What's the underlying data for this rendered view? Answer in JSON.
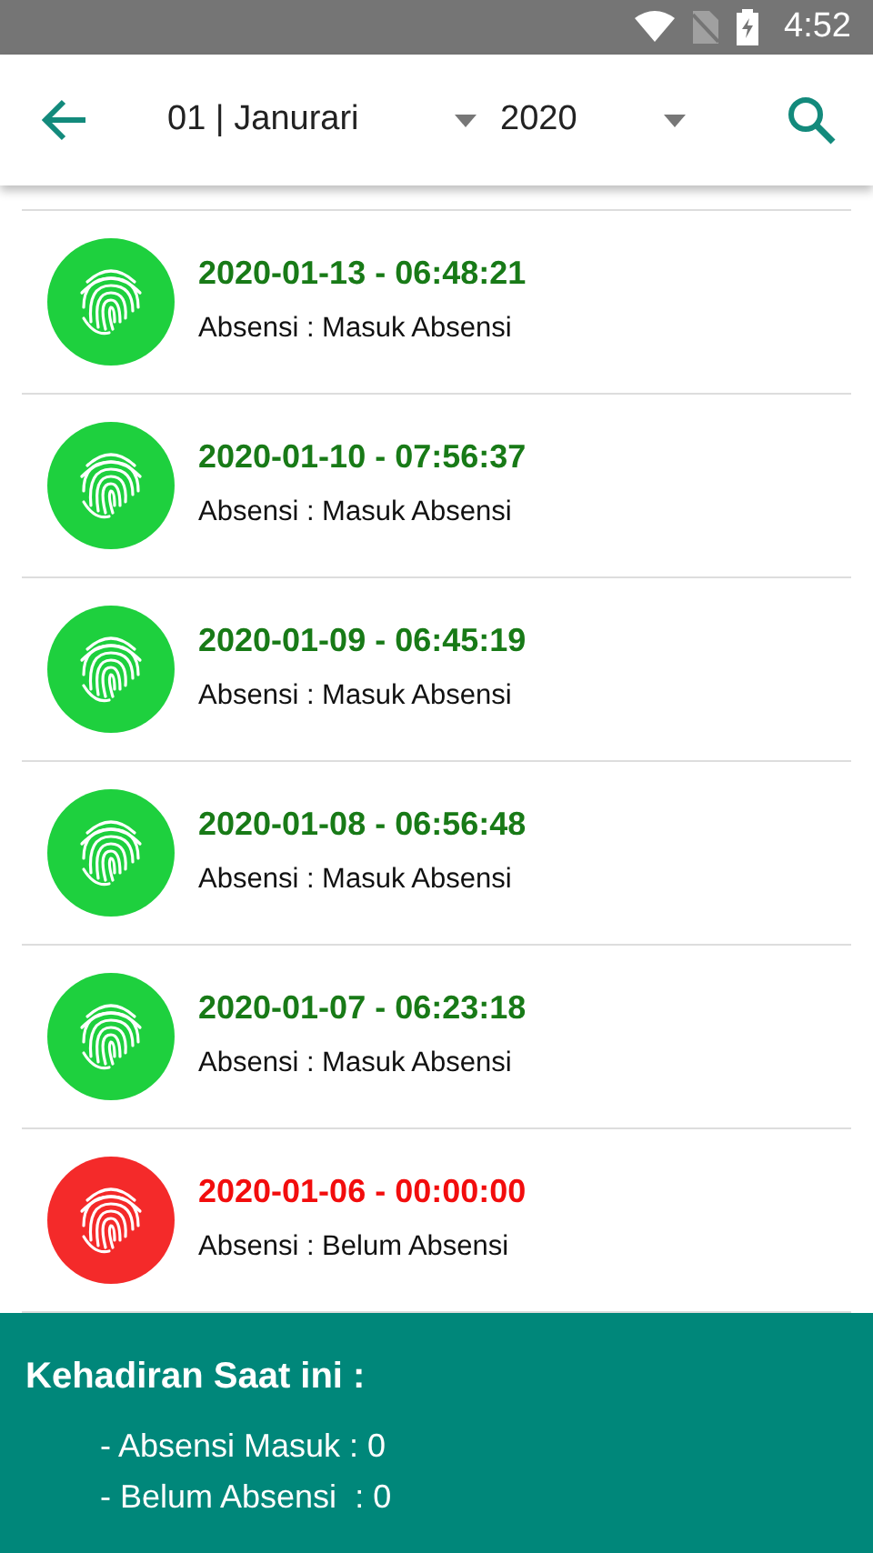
{
  "status_bar": {
    "time": "4:52"
  },
  "toolbar": {
    "month": "01 | Janurari",
    "year": "2020"
  },
  "entries": [
    {
      "kind": "masuk",
      "datetime": "2020-01-13 - 06:48:21",
      "status": "Absensi : Masuk Absensi"
    },
    {
      "kind": "masuk",
      "datetime": "2020-01-10 - 07:56:37",
      "status": "Absensi : Masuk Absensi"
    },
    {
      "kind": "masuk",
      "datetime": "2020-01-09 - 06:45:19",
      "status": "Absensi : Masuk Absensi"
    },
    {
      "kind": "masuk",
      "datetime": "2020-01-08 - 06:56:48",
      "status": "Absensi : Masuk Absensi"
    },
    {
      "kind": "masuk",
      "datetime": "2020-01-07 - 06:23:18",
      "status": "Absensi : Masuk Absensi"
    },
    {
      "kind": "belum",
      "datetime": "2020-01-06 - 00:00:00",
      "status": "Absensi : Belum Absensi"
    }
  ],
  "summary": {
    "title": "Kehadiran Saat ini :",
    "lines": [
      "- Absensi Masuk : 0",
      "- Belum Absensi  : 0"
    ]
  }
}
